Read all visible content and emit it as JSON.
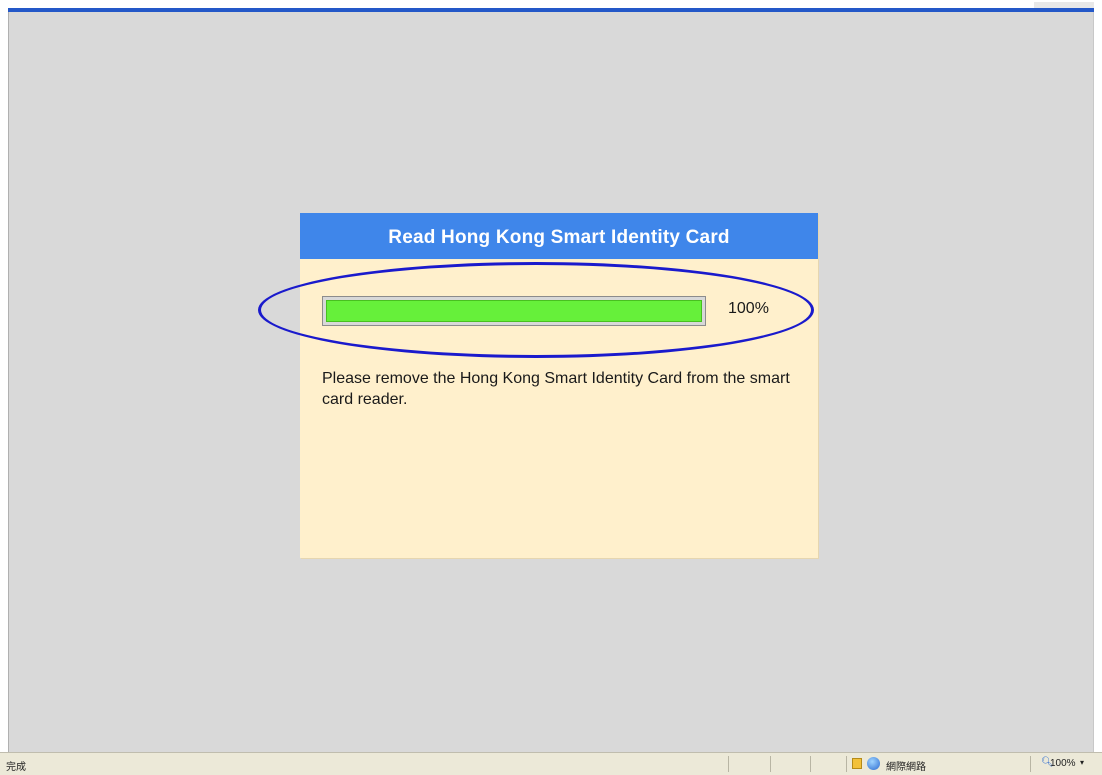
{
  "dialog": {
    "title": "Read Hong Kong Smart Identity Card",
    "progress_fraction": 1.0,
    "progress_label": "100%",
    "message": "Please remove the Hong Kong Smart Identity Card from the smart card reader."
  },
  "status_bar": {
    "status_text": "完成",
    "zone_text": "網際網路",
    "zoom_text": "100%",
    "zoom_arrow": "▾"
  },
  "colors": {
    "header_blue": "#3f86ea",
    "dialog_bg": "#fff0cc",
    "progress_green": "#66f03a",
    "highlight_ellipse": "#1a1acc",
    "page_bg": "#d9d9d9"
  },
  "icons": {
    "lock": "lock-icon",
    "globe": "globe-icon",
    "zoom": "zoom-icon"
  }
}
